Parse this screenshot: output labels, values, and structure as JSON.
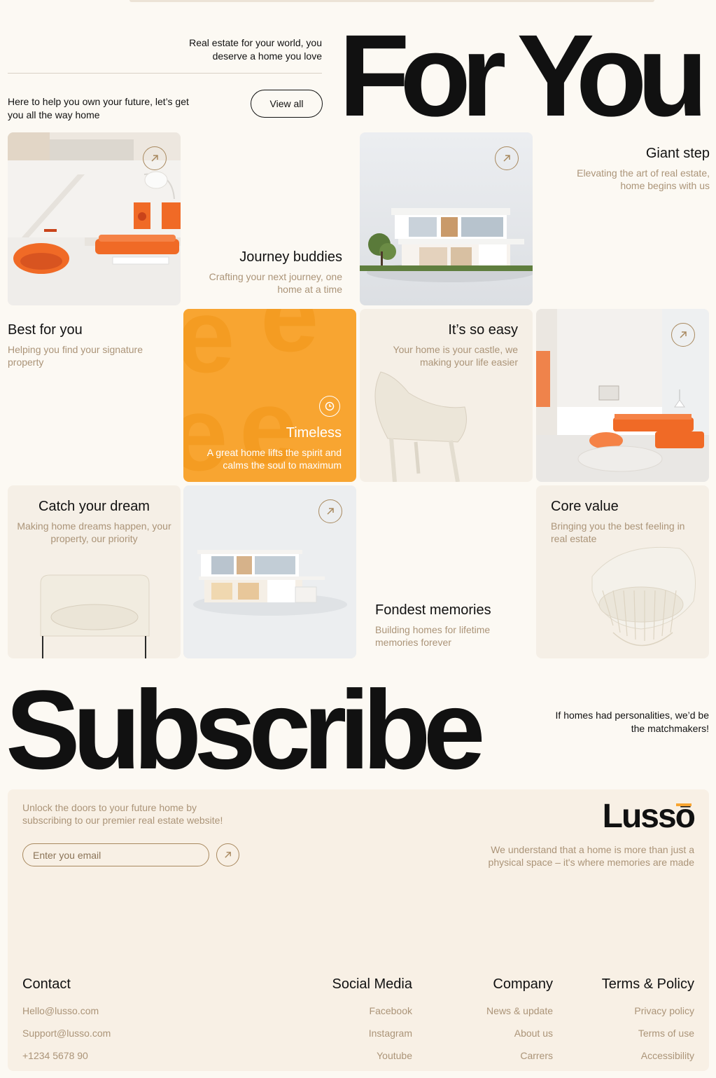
{
  "hero": {
    "tagline": "Real estate for your world, you deserve a home you love",
    "subline": "Here to help you own your future, let’s get you all the way home",
    "view_all": "View all",
    "big_title": "For You"
  },
  "tiles": {
    "journey": {
      "title": "Journey buddies",
      "desc": "Crafting your next journey, one home at a time"
    },
    "giant": {
      "title": "Giant step",
      "desc": "Elevating the art of real estate, home begins with us"
    },
    "best": {
      "title": "Best for you",
      "desc": "Helping you find your signature property"
    },
    "timeless": {
      "title": "Timeless",
      "desc": "A great home lifts the spirit and calms the soul to maximum"
    },
    "easy": {
      "title": "It’s so easy",
      "desc": "Your home is your castle, we making your life easier"
    },
    "catch": {
      "title": "Catch your dream",
      "desc": "Making home dreams happen, your property, our priority"
    },
    "fondest": {
      "title": "Fondest memories",
      "desc": "Building homes for lifetime memories forever"
    },
    "core": {
      "title": "Core value",
      "desc": "Bringing you the best feeling in real estate"
    }
  },
  "subscribe": {
    "title": "Subscribe",
    "note": "If homes had personalities, we’d be the matchmakers!"
  },
  "footer": {
    "intro": "Unlock the doors to your future home by subscribing to our premier real estate website!",
    "email_placeholder": "Enter you email",
    "logo": "Lussō",
    "statement": "We understand that a home is more than just a physical space – it's where memories are made",
    "contact": {
      "heading": "Contact",
      "items": [
        "Hello@lusso.com",
        "Support@lusso.com",
        "+1234 5678 90"
      ]
    },
    "social": {
      "heading": "Social Media",
      "items": [
        "Facebook",
        "Instagram",
        "Youtube"
      ]
    },
    "company": {
      "heading": "Company",
      "items": [
        "News & update",
        "About us",
        "Carrers"
      ]
    },
    "terms": {
      "heading": "Terms & Policy",
      "items": [
        "Privacy policy",
        "Terms of use",
        "Accessibility"
      ]
    }
  },
  "colors": {
    "background": "#fcf9f3",
    "accent_orange": "#f8a531",
    "muted_text": "#ab9478",
    "beige_tile": "#f5efe6",
    "sofa_orange": "#f06a26"
  }
}
